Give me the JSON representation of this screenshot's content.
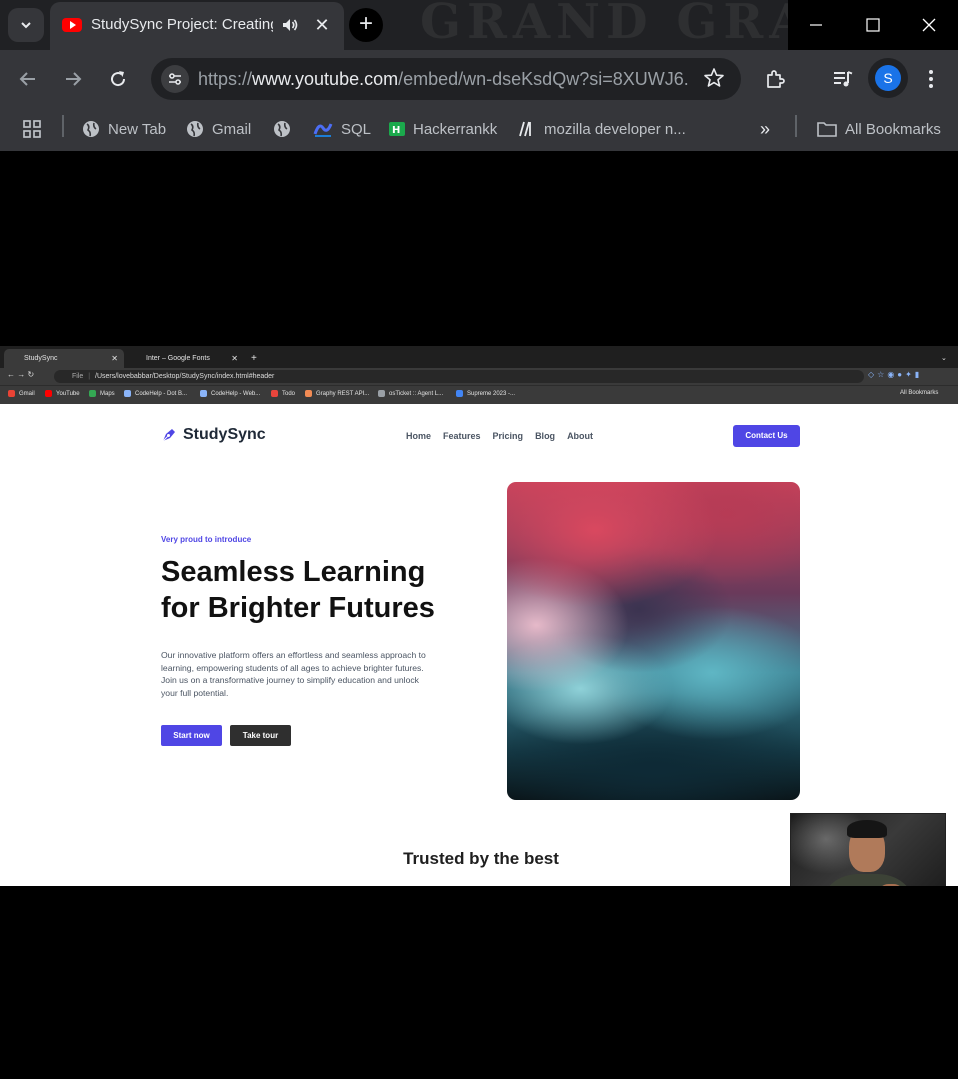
{
  "browser": {
    "tab_title": "StudySync Project: Creating",
    "url_prefix": "https://",
    "url_host": "www.youtube.com",
    "url_path": "/embed/wn-dseKsdQw?si=8XUWJ6...",
    "avatar_letter": "S",
    "bookmarks": [
      {
        "label": "New Tab"
      },
      {
        "label": "Gmail"
      },
      {
        "label": ""
      },
      {
        "label": "SQL"
      },
      {
        "label": "Hackerrankk"
      },
      {
        "label": "mozilla developer n..."
      }
    ],
    "all_bookmarks": "All Bookmarks",
    "overflow": "»",
    "background_art_text": "GRAND GRA"
  },
  "video": {
    "inner_browser": {
      "tabs": [
        {
          "label": "StudySync"
        },
        {
          "label": "Inter – Google Fonts"
        }
      ],
      "file_label": "File",
      "url": "/Users/lovebabbar/Desktop/StudySync/index.html#header",
      "bookmarks": [
        {
          "label": "Gmail",
          "color": "#ea4335"
        },
        {
          "label": "YouTube",
          "color": "#ff0000"
        },
        {
          "label": "Maps",
          "color": "#34a853"
        },
        {
          "label": "CodeHelp - Dot B...",
          "color": "#8ab4f8"
        },
        {
          "label": "CodeHelp - Web...",
          "color": "#8ab4f8"
        },
        {
          "label": "Todo",
          "color": "#e8453c"
        },
        {
          "label": "Graphy REST API...",
          "color": "#f28b54"
        },
        {
          "label": "osTicket :: Agent L...",
          "color": "#9aa0a6"
        },
        {
          "label": "Supreme 2023 -...",
          "color": "#4285f4"
        }
      ],
      "all_bookmarks": "All Bookmarks"
    },
    "site": {
      "brand": "StudySync",
      "nav": [
        "Home",
        "Features",
        "Pricing",
        "Blog",
        "About"
      ],
      "contact": "Contact Us",
      "eyebrow": "Very proud to introduce",
      "headline_line1": "Seamless Learning",
      "headline_line2": "for Brighter Futures",
      "lead": "Our innovative platform offers an effortless and seamless approach to learning, empowering students of all ages to achieve brighter futures. Join us on a transformative journey to simplify education and unlock your full potential.",
      "btn_start": "Start now",
      "btn_tour": "Take tour",
      "trusted": "Trusted by the best",
      "accent": "#4f46e5"
    }
  }
}
